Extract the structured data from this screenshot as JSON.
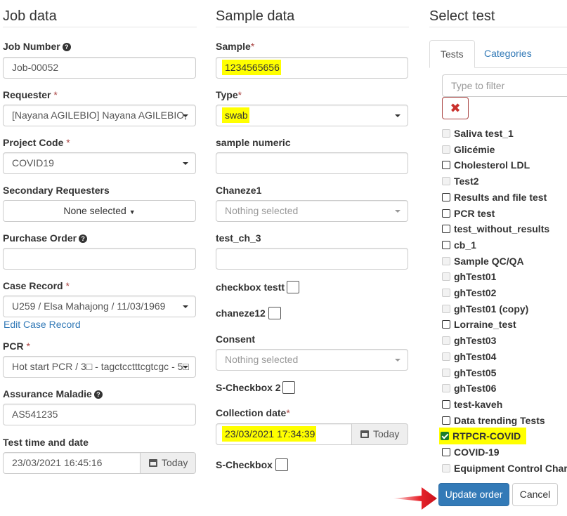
{
  "job": {
    "title": "Job data",
    "job_number_label": "Job Number",
    "job_number_value": "Job-00052",
    "requester_label": "Requester",
    "requester_value": "[Nayana AGILEBIO] Nayana AGILEBIO, ",
    "project_label": "Project Code",
    "project_value": "COVID19",
    "secondary_label": "Secondary Requesters",
    "secondary_value": "None selected",
    "purchase_label": "Purchase Order",
    "purchase_value": "",
    "case_label": "Case Record",
    "case_value": "U259 / Elsa Mahajong / 11/03/1969",
    "edit_case_link": "Edit Case Record",
    "pcr_label": "PCR",
    "pcr_value": "Hot start PCR / 3□ - tagctcctttcgtcgc - 5□",
    "assurance_label": "Assurance Maladie",
    "assurance_value": "AS541235",
    "test_time_label": "Test time and date",
    "test_time_value": "23/03/2021 16:45:16",
    "today_label": "Today",
    "required_mark": "*"
  },
  "sample": {
    "title": "Sample data",
    "sample_label": "Sample",
    "sample_value": "1234565656",
    "type_label": "Type",
    "type_value": "swab",
    "numeric_label": "sample numeric",
    "numeric_value": "",
    "chaneze1_label": "Chaneze1",
    "chaneze1_value": "Nothing selected",
    "test_ch_label": "test_ch_3",
    "test_ch_value": "",
    "checkbox_testt_label": "checkbox testt",
    "chaneze12_label": "chaneze12",
    "consent_label": "Consent",
    "consent_value": "Nothing selected",
    "scheckbox2_label": "S-Checkbox 2",
    "collection_label": "Collection date",
    "collection_value": "23/03/2021 17:34:39",
    "today_label": "Today",
    "scheckbox_label": "S-Checkbox",
    "required_mark": "*"
  },
  "tests": {
    "title": "Select test",
    "tabs": [
      "Tests",
      "Categories"
    ],
    "filter_placeholder": "Type to filter",
    "clear_icon": "✖",
    "items": [
      {
        "label": "Saliva test_1",
        "state": "disabled"
      },
      {
        "label": "Glicémie",
        "state": "disabled"
      },
      {
        "label": "Cholesterol LDL",
        "state": "unchecked"
      },
      {
        "label": "Test2",
        "state": "disabled"
      },
      {
        "label": "Results and file test",
        "state": "unchecked"
      },
      {
        "label": "PCR test",
        "state": "unchecked"
      },
      {
        "label": "test_without_results",
        "state": "unchecked"
      },
      {
        "label": "cb_1",
        "state": "unchecked"
      },
      {
        "label": "Sample QC/QA",
        "state": "disabled"
      },
      {
        "label": "ghTest01",
        "state": "disabled"
      },
      {
        "label": "ghTest02",
        "state": "disabled"
      },
      {
        "label": "ghTest01 (copy)",
        "state": "disabled"
      },
      {
        "label": "Lorraine_test",
        "state": "unchecked"
      },
      {
        "label": "ghTest03",
        "state": "disabled"
      },
      {
        "label": "ghTest04",
        "state": "disabled"
      },
      {
        "label": "ghTest05",
        "state": "disabled"
      },
      {
        "label": "ghTest06",
        "state": "disabled"
      },
      {
        "label": "test-kaveh",
        "state": "unchecked"
      },
      {
        "label": "Data trending Tests",
        "state": "unchecked"
      },
      {
        "label": "RTPCR-COVID",
        "state": "checked"
      },
      {
        "label": "COVID-19",
        "state": "unchecked"
      },
      {
        "label": "Equipment Control Chart",
        "state": "disabled"
      }
    ]
  },
  "actions": {
    "update_label": "Update order",
    "cancel_label": "Cancel"
  },
  "colors": {
    "primary": "#337ab7",
    "highlight": "#ffff00",
    "required": "#a94442",
    "arrow": "#e8242c"
  }
}
